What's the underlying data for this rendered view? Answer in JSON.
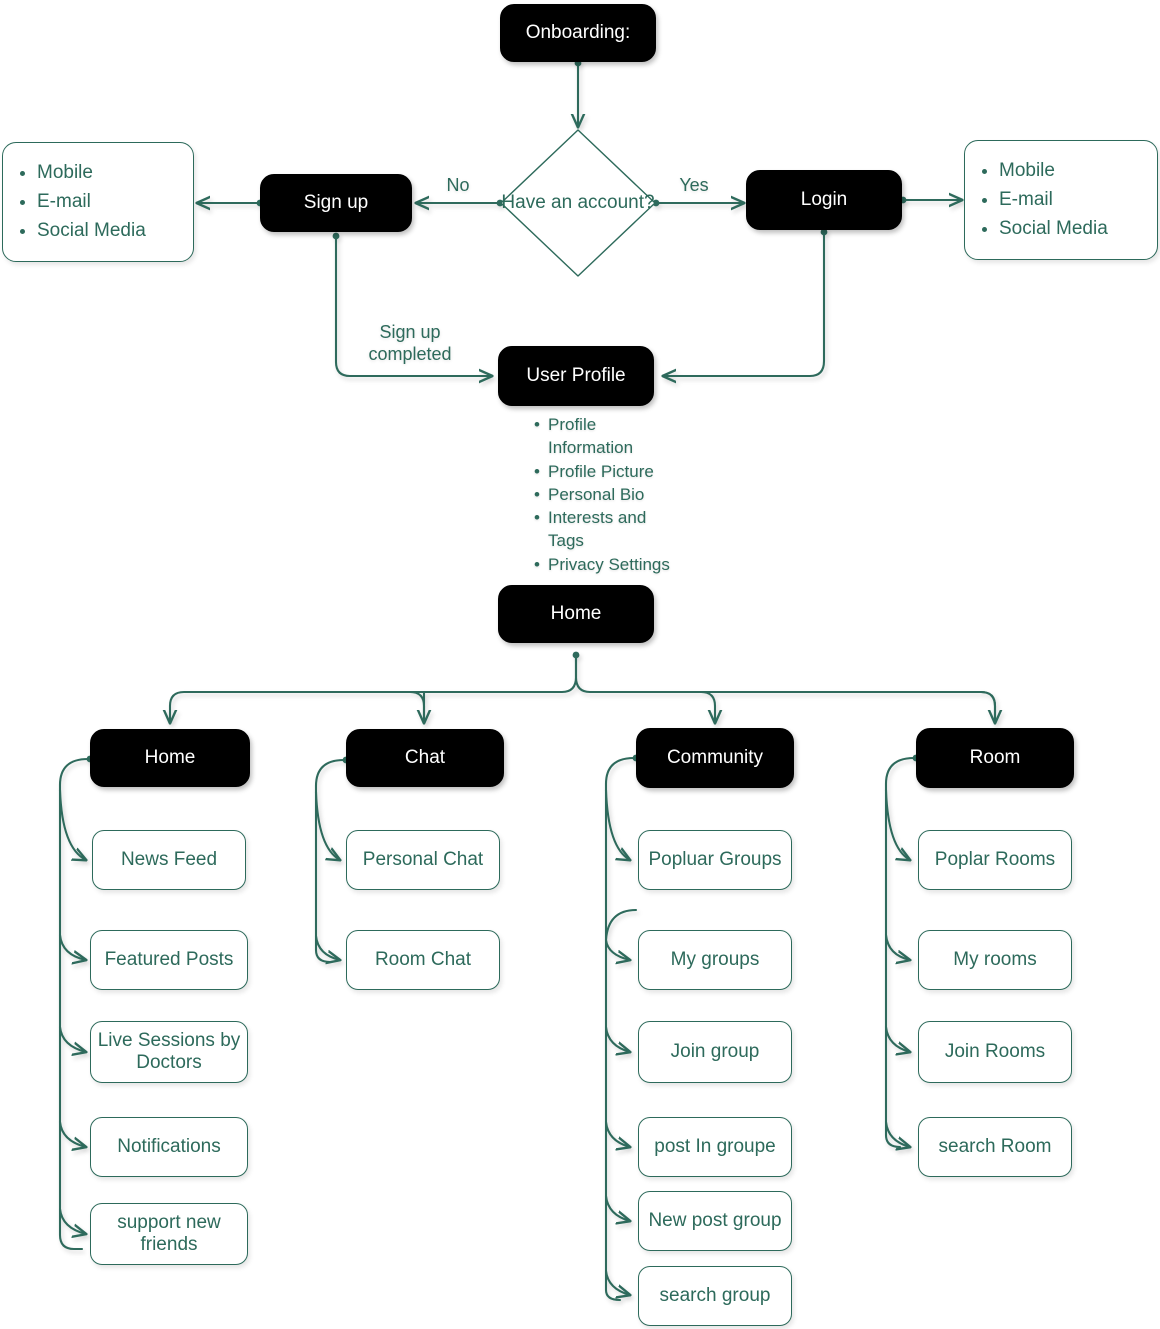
{
  "theme": {
    "accent": "#2d6a5b",
    "dark_node_bg": "#000000",
    "dark_node_text": "#ffffff",
    "canvas_bg": "#ffffff"
  },
  "flow": {
    "title_node": {
      "label": "Onboarding:"
    },
    "decision": {
      "label": "Have an\naccount?"
    },
    "edge_labels": {
      "no": "No",
      "yes": "Yes",
      "signup_completed": "Sign up\ncompleted"
    },
    "signup_node": {
      "label": "Sign up"
    },
    "login_node": {
      "label": "Login"
    },
    "signup_methods": {
      "items": [
        "Mobile",
        "E-mail",
        "Social Media"
      ]
    },
    "login_methods": {
      "items": [
        "Mobile",
        "E-mail",
        "Social Media"
      ]
    },
    "user_profile": {
      "label": "User Profile"
    },
    "user_profile_items": [
      "Profile Information",
      "Profile Picture",
      "Personal Bio",
      "Interests and Tags",
      "Privacy Settings"
    ],
    "home_root": {
      "label": "Home"
    },
    "branches": [
      {
        "label": "Home",
        "children": [
          "News Feed",
          "Featured Posts",
          "Live Sessions by Doctors",
          "Notifications",
          "support new friends"
        ]
      },
      {
        "label": "Chat",
        "children": [
          "Personal Chat",
          "Room Chat"
        ]
      },
      {
        "label": "Community",
        "children": [
          "Popluar Groups",
          "My groups",
          "Join group",
          "post In groupe",
          "New post group",
          "search group"
        ]
      },
      {
        "label": "Room",
        "children": [
          "Poplar Rooms",
          "My rooms",
          "Join Rooms",
          "search Room"
        ]
      }
    ]
  }
}
